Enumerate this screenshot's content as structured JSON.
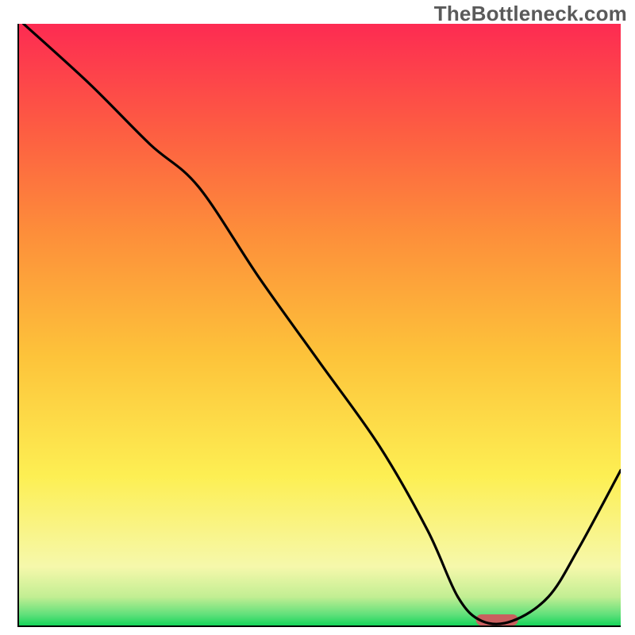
{
  "watermark": "TheBottleneck.com",
  "chart_data": {
    "type": "line",
    "title": "",
    "xlabel": "",
    "ylabel": "",
    "xlim": [
      0,
      100
    ],
    "ylim": [
      0,
      100
    ],
    "grid": false,
    "legend": false,
    "series": [
      {
        "name": "curve",
        "x": [
          1,
          12,
          22,
          30,
          40,
          50,
          60,
          68,
          73,
          77,
          82,
          88,
          93,
          100
        ],
        "y": [
          100,
          90,
          80,
          73,
          58,
          44,
          30,
          16,
          5,
          1,
          1,
          5,
          13,
          26
        ]
      }
    ],
    "marker": {
      "name": "optimum-marker",
      "x_center": 79.5,
      "width_pct": 7,
      "color": "#c95f5f"
    },
    "gradient_stops": [
      {
        "offset": 0,
        "color": "#0bd254"
      },
      {
        "offset": 0.02,
        "color": "#5ee07a"
      },
      {
        "offset": 0.05,
        "color": "#c2ee93"
      },
      {
        "offset": 0.1,
        "color": "#f6f8ab"
      },
      {
        "offset": 0.25,
        "color": "#fdef53"
      },
      {
        "offset": 0.45,
        "color": "#fdc33a"
      },
      {
        "offset": 0.65,
        "color": "#fd8f3a"
      },
      {
        "offset": 0.82,
        "color": "#fd5e42"
      },
      {
        "offset": 1.0,
        "color": "#fd2b52"
      }
    ]
  }
}
